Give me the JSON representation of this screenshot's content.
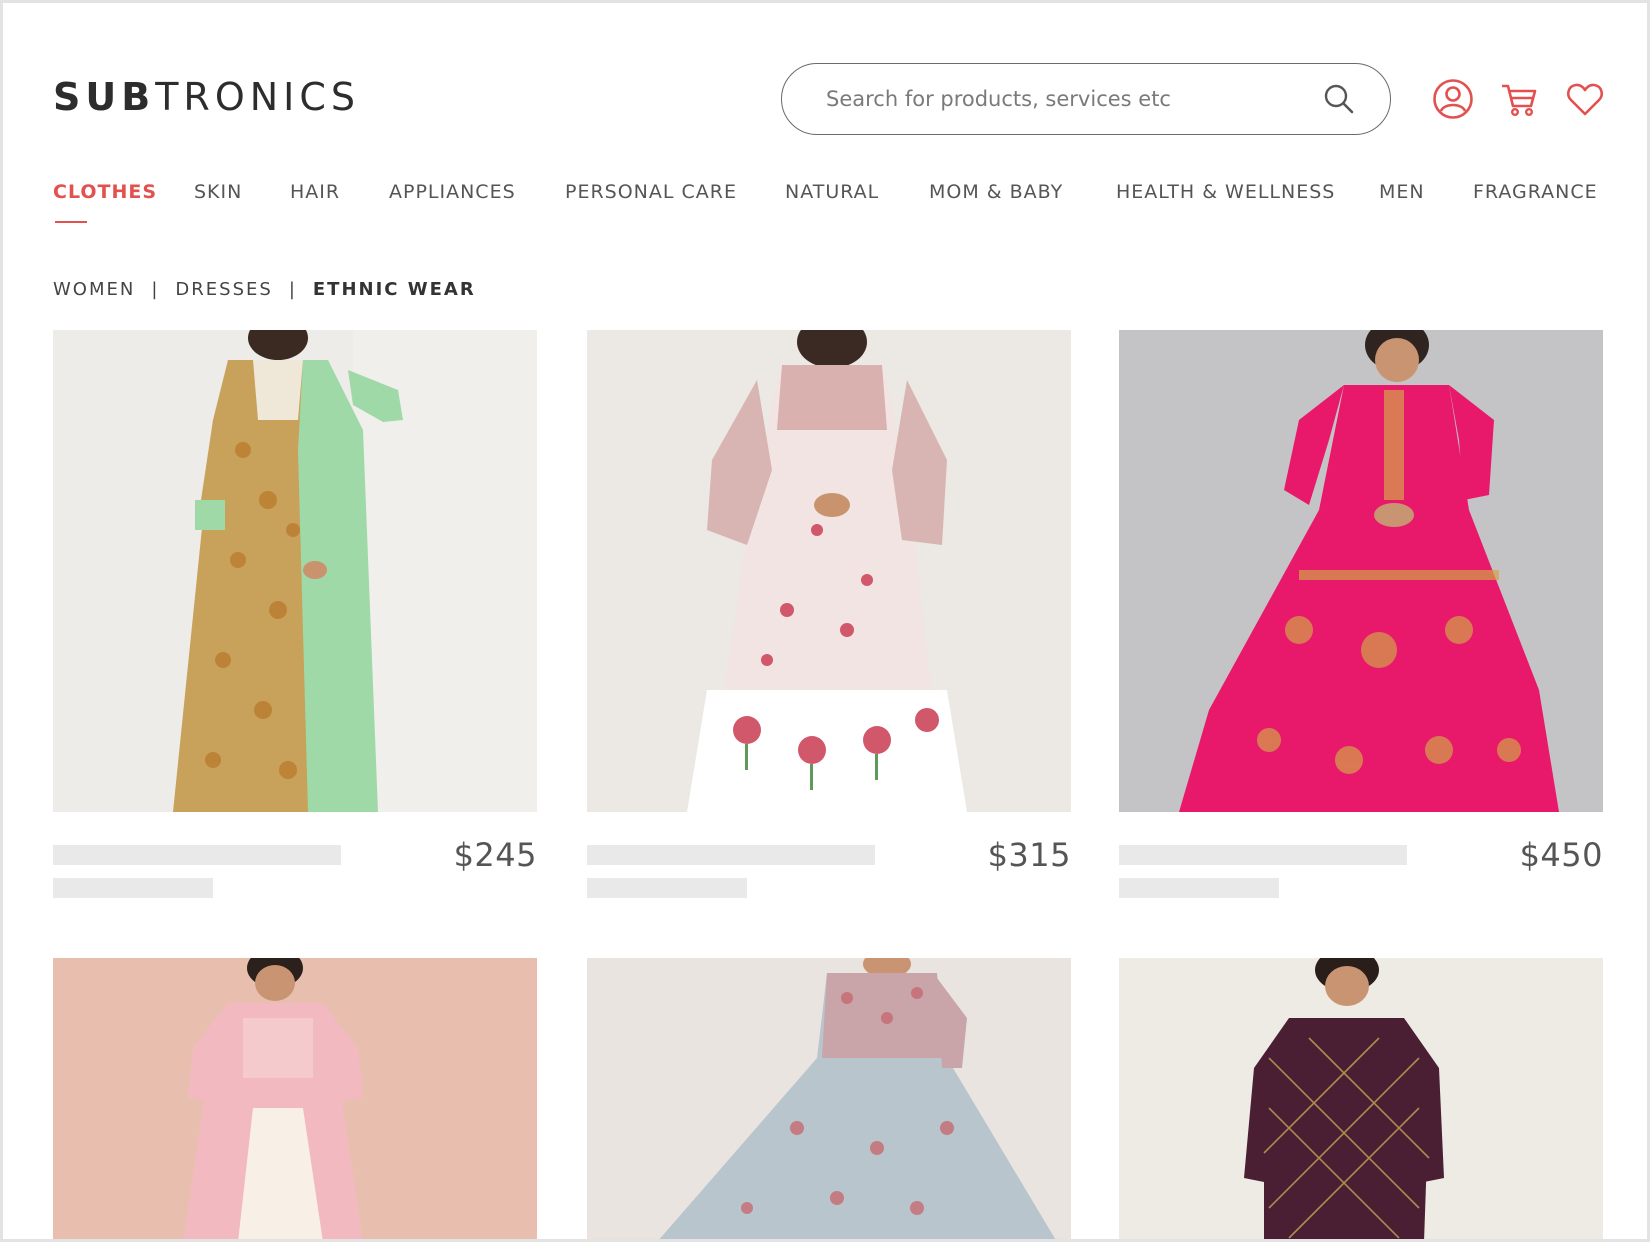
{
  "brand": {
    "bold": "SUB",
    "light": "TRONICS"
  },
  "search": {
    "placeholder": "Search for products, services etc",
    "value": ""
  },
  "header_icons": [
    "search-icon",
    "user-icon",
    "cart-icon",
    "heart-icon"
  ],
  "accent_color": "#e2514f",
  "nav": {
    "items": [
      {
        "label": "CLOTHES",
        "active": true
      },
      {
        "label": "SKIN"
      },
      {
        "label": "HAIR"
      },
      {
        "label": "APPLIANCES"
      },
      {
        "label": "PERSONAL CARE"
      },
      {
        "label": "NATURAL"
      },
      {
        "label": "MOM & BABY"
      },
      {
        "label": "HEALTH & WELLNESS"
      },
      {
        "label": "MEN"
      },
      {
        "label": "FRAGRANCE"
      }
    ]
  },
  "breadcrumb": {
    "items": [
      "WOMEN",
      "DRESSES",
      "ETHNIC WEAR"
    ],
    "separator": "|"
  },
  "products": [
    {
      "price": "$245",
      "image": "green floral anarkali dress",
      "bg": "#eeece8"
    },
    {
      "price": "$315",
      "image": "white pink block-print tiered dress",
      "bg": "#ece8e4"
    },
    {
      "price": "$450",
      "image": "magenta pink gold-print anarkali dress",
      "bg": "#c4c4c6"
    },
    {
      "price": "",
      "image": "pink embroidered kurta with skirt",
      "bg": "#e8bfae"
    },
    {
      "price": "",
      "image": "grey-blue printed flared dress",
      "bg": "#e9e4e0"
    },
    {
      "price": "",
      "image": "maroon gold-check kurta",
      "bg": "#eeebe4"
    }
  ]
}
